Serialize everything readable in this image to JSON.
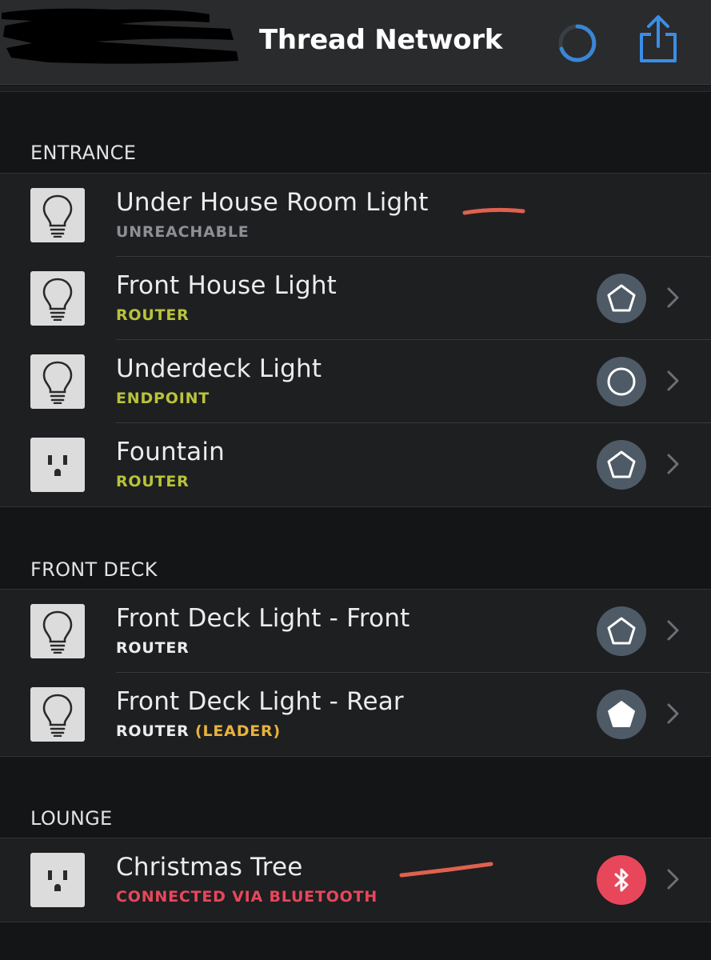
{
  "nav": {
    "title": "Thread Network",
    "left_item": "redacted",
    "loading_icon": "spinner-icon",
    "share_icon": "share-icon"
  },
  "colors": {
    "router": "#b9c33a",
    "endpoint": "#b9c33a",
    "unreachable": "#8e8e93",
    "leader": "#e8b23c",
    "bluetooth": "#e8475b",
    "annotation": "#e0614f"
  },
  "sections": [
    {
      "title": "ENTRANCE",
      "items": [
        {
          "name": "Under House Room Light",
          "icon": "lightbulb-icon",
          "status": "UNREACHABLE",
          "role": ""
        },
        {
          "name": "Front House Light",
          "icon": "lightbulb-icon",
          "status": "ROUTER",
          "role": "router"
        },
        {
          "name": "Underdeck Light",
          "icon": "lightbulb-icon",
          "status": "ENDPOINT",
          "role": "endpoint"
        },
        {
          "name": "Fountain",
          "icon": "outlet-icon",
          "status": "ROUTER",
          "role": "router"
        }
      ]
    },
    {
      "title": "FRONT DECK",
      "items": [
        {
          "name": "Front Deck Light - Front",
          "icon": "lightbulb-icon",
          "status": "ROUTER",
          "role": "router"
        },
        {
          "name": "Front Deck Light - Rear",
          "icon": "lightbulb-icon",
          "status": "ROUTER",
          "status_extra": "(LEADER)",
          "role": "leader"
        }
      ]
    },
    {
      "title": "LOUNGE",
      "items": [
        {
          "name": "Christmas Tree",
          "icon": "outlet-icon",
          "status": "CONNECTED VIA BLUETOOTH",
          "role": "bluetooth"
        }
      ]
    }
  ]
}
